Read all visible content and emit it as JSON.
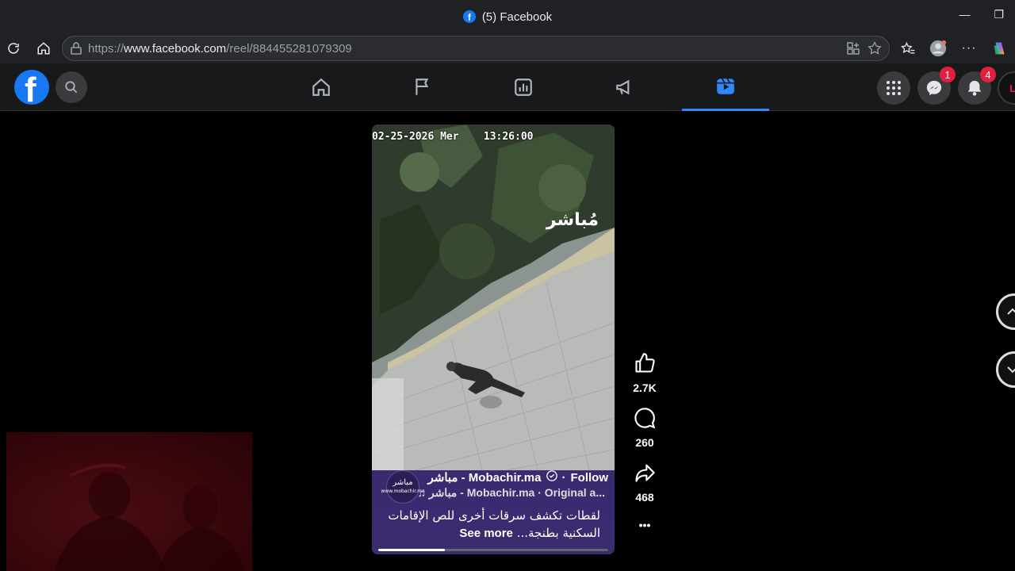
{
  "browser": {
    "window_title": "(5) Facebook",
    "url_scheme": "https://",
    "url_host": "www.facebook.com",
    "url_path": "/reel/884455281079309"
  },
  "facebook": {
    "logo_letter": "f",
    "messenger_badge": "1",
    "notifications_badge": "4",
    "profile_initials": "LI"
  },
  "reel": {
    "timestamp": "02-25-2026 Mer    13:26:00",
    "video_watermark": "مُباشر",
    "avatar_text": "مباشر",
    "author": "مباشر - Mobachir.ma",
    "follow_label": "Follow",
    "avatar_subtext": "www.mobachir.ma",
    "audio": "مباشر - Mobachir.ma · Original a...",
    "caption": "لقطات تكشف سرقات أخرى للص الإقامات السكنية بطنجة...",
    "see_more": "See more",
    "progress": 0.29
  },
  "actions": {
    "likes": "2.7K",
    "comments": "260",
    "shares": "468",
    "more": "•••"
  },
  "colors": {
    "brand": "#1877f2",
    "active_tab": "#2d88ff",
    "badge": "#e41e3f",
    "top_bar": "#18191a"
  }
}
